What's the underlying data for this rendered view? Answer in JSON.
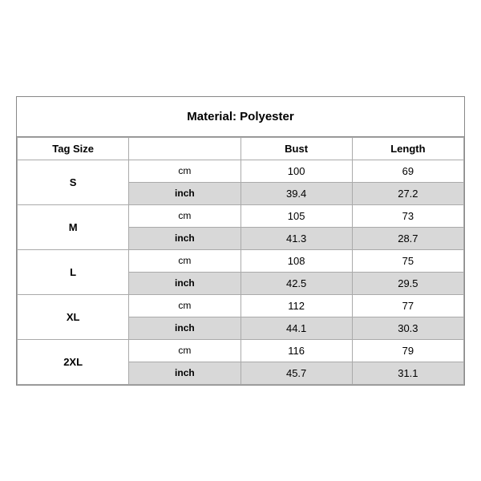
{
  "title": "Material: Polyester",
  "columns": {
    "tag_size": "Tag Size",
    "unit": "",
    "bust": "Bust",
    "length": "Length"
  },
  "sizes": [
    {
      "tag": "S",
      "cm": {
        "bust": "100",
        "length": "69"
      },
      "inch": {
        "bust": "39.4",
        "length": "27.2"
      }
    },
    {
      "tag": "M",
      "cm": {
        "bust": "105",
        "length": "73"
      },
      "inch": {
        "bust": "41.3",
        "length": "28.7"
      }
    },
    {
      "tag": "L",
      "cm": {
        "bust": "108",
        "length": "75"
      },
      "inch": {
        "bust": "42.5",
        "length": "29.5"
      }
    },
    {
      "tag": "XL",
      "cm": {
        "bust": "112",
        "length": "77"
      },
      "inch": {
        "bust": "44.1",
        "length": "30.3"
      }
    },
    {
      "tag": "2XL",
      "cm": {
        "bust": "116",
        "length": "79"
      },
      "inch": {
        "bust": "45.7",
        "length": "31.1"
      }
    }
  ],
  "units": {
    "cm": "cm",
    "inch": "inch"
  }
}
